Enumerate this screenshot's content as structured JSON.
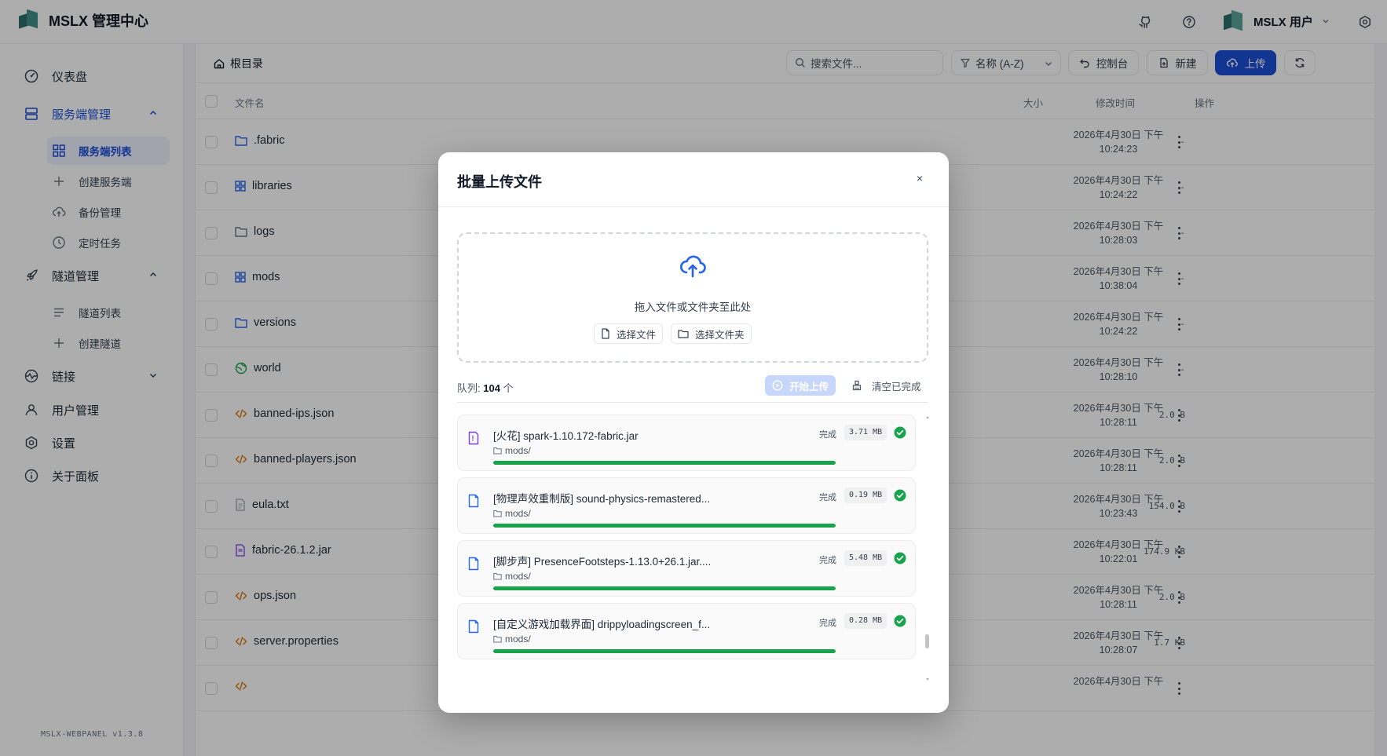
{
  "app": {
    "title": "MSLX 管理中心",
    "user": "MSLX 用户",
    "version": "MSLX-WEBPANEL v1.3.8"
  },
  "sidebar": {
    "items": [
      {
        "label": "仪表盘",
        "icon": "dashboard-icon"
      },
      {
        "label": "服务端管理",
        "icon": "server-icon",
        "expanded": true
      },
      {
        "label": "隧道管理",
        "icon": "rocket-icon",
        "expanded": true
      },
      {
        "label": "链接",
        "icon": "link-icon",
        "expanded": false
      },
      {
        "label": "用户管理",
        "icon": "user-icon"
      },
      {
        "label": "设置",
        "icon": "settings-icon"
      },
      {
        "label": "关于面板",
        "icon": "info-icon"
      }
    ],
    "server_sub": [
      {
        "label": "服务端列表",
        "icon": "grid-icon",
        "active": true
      },
      {
        "label": "创建服务端",
        "icon": "plus-icon"
      },
      {
        "label": "备份管理",
        "icon": "cloud-upload-icon"
      },
      {
        "label": "定时任务",
        "icon": "clock-icon"
      }
    ],
    "tunnel_sub": [
      {
        "label": "隧道列表",
        "icon": "list-icon"
      },
      {
        "label": "创建隧道",
        "icon": "plus-icon"
      }
    ]
  },
  "toolbar": {
    "breadcrumb": "根目录",
    "search_placeholder": "搜索文件...",
    "sort_label": "名称 (A-Z)",
    "console_label": "控制台",
    "new_label": "新建",
    "upload_label": "上传"
  },
  "table": {
    "columns": {
      "name": "文件名",
      "size": "大小",
      "modified": "修改时间",
      "actions": "操作"
    },
    "rows": [
      {
        "name": ".fabric",
        "type": "folder",
        "size": "-",
        "date": "2026年4月30日 下午",
        "time": "10:24:23"
      },
      {
        "name": "libraries",
        "type": "grid-folder",
        "size": "-",
        "date": "2026年4月30日 下午",
        "time": "10:24:22"
      },
      {
        "name": "logs",
        "type": "folder-gray",
        "size": "-",
        "date": "2026年4月30日 下午",
        "time": "10:28:03"
      },
      {
        "name": "mods",
        "type": "grid-folder",
        "size": "-",
        "date": "2026年4月30日 下午",
        "time": "10:38:04"
      },
      {
        "name": "versions",
        "type": "folder",
        "size": "-",
        "date": "2026年4月30日 下午",
        "time": "10:24:22"
      },
      {
        "name": "world",
        "type": "globe",
        "size": "-",
        "date": "2026年4月30日 下午",
        "time": "10:28:10"
      },
      {
        "name": "banned-ips.json",
        "type": "code",
        "size": "2.0 B",
        "date": "2026年4月30日 下午",
        "time": "10:28:11"
      },
      {
        "name": "banned-players.json",
        "type": "code",
        "size": "2.0 B",
        "date": "2026年4月30日 下午",
        "time": "10:28:11"
      },
      {
        "name": "eula.txt",
        "type": "text",
        "size": "154.0 B",
        "date": "2026年4月30日 下午",
        "time": "10:23:43"
      },
      {
        "name": "fabric-26.1.2.jar",
        "type": "jar",
        "size": "174.9 KB",
        "date": "2026年4月30日 下午",
        "time": "10:22:01"
      },
      {
        "name": "ops.json",
        "type": "code",
        "size": "2.0 B",
        "date": "2026年4月30日 下午",
        "time": "10:28:11"
      },
      {
        "name": "server.properties",
        "type": "code",
        "size": "1.7 KB",
        "date": "2026年4月30日 下午",
        "time": "10:28:07"
      },
      {
        "name": "",
        "type": "code",
        "size": "",
        "date": "2026年4月30日 下午",
        "time": ""
      }
    ]
  },
  "modal": {
    "title": "批量上传文件",
    "drop_text": "拖入文件或文件夹至此处",
    "select_file": "选择文件",
    "select_folder": "选择文件夹",
    "queue_prefix": "队列:",
    "queue_count": "104",
    "queue_unit": "个",
    "start_label": "开始上传",
    "clear_label": "清空已完成",
    "items": [
      {
        "name": "[火花] spark-1.10.172-fabric.jar",
        "path": "mods/",
        "status": "完成",
        "size": "3.71 MB",
        "progress": 1.0,
        "icon": "jar-file-icon"
      },
      {
        "name": "[物理声效重制版] sound-physics-remastered...",
        "path": "mods/",
        "status": "完成",
        "size": "0.19 MB",
        "progress": 1.0,
        "icon": "file-icon"
      },
      {
        "name": "[脚步声] PresenceFootsteps-1.13.0+26.1.jar....",
        "path": "mods/",
        "status": "完成",
        "size": "5.48 MB",
        "progress": 1.0,
        "icon": "file-icon"
      },
      {
        "name": "[自定义游戏加载界面] drippyloadingscreen_f...",
        "path": "mods/",
        "status": "完成",
        "size": "0.28 MB",
        "progress": 1.0,
        "icon": "file-icon"
      }
    ]
  },
  "colors": {
    "accent": "#1d4ed8",
    "success": "#16a34a",
    "folder": "#2563eb",
    "code": "#d97706",
    "jar": "#7c3aed"
  }
}
